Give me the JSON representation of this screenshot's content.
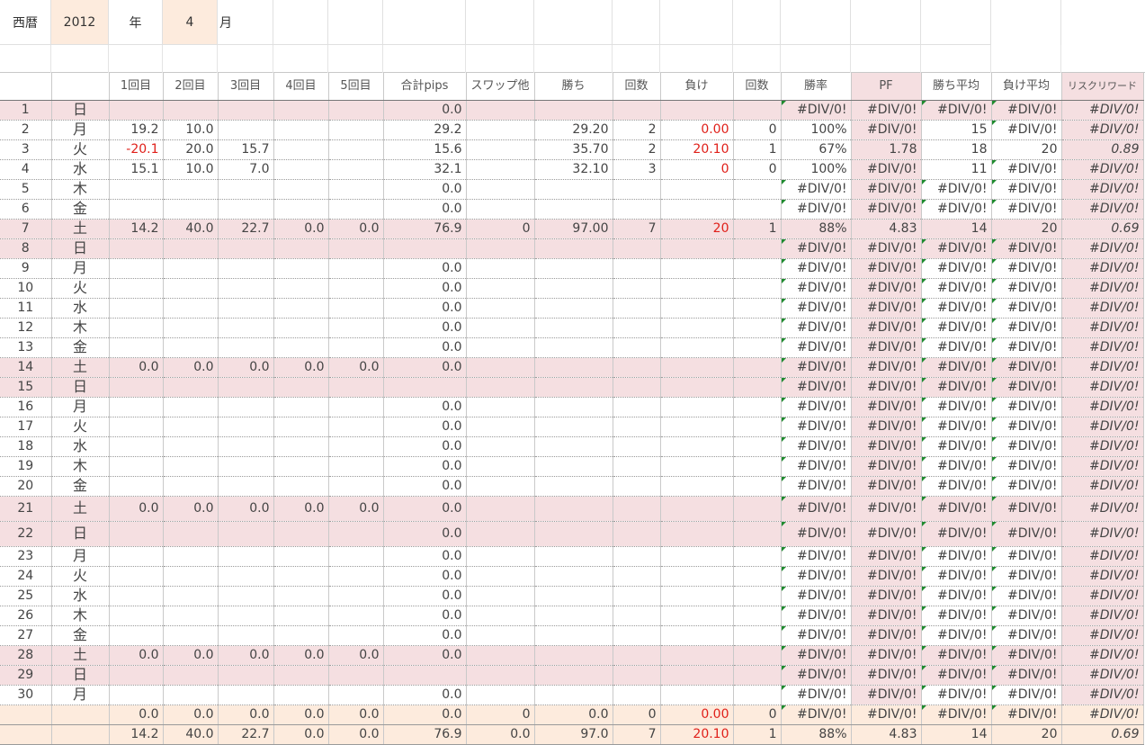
{
  "header": {
    "era_label": "西暦",
    "year": "2012",
    "year_unit": "年",
    "month": "4",
    "month_unit": "月"
  },
  "columns": [
    "",
    "",
    "1回目",
    "2回目",
    "3回目",
    "4回目",
    "5回目",
    "合計pips",
    "スワップ他",
    "勝ち",
    "回数",
    "負け",
    "回数",
    "勝率",
    "PF",
    "勝ち平均",
    "負け平均",
    "リスクリワード"
  ],
  "rows": [
    [
      "1",
      "日",
      "",
      "",
      "",
      "",
      "",
      "0.0",
      "",
      "",
      "",
      "",
      "",
      "#DIV/0!",
      "#DIV/0!",
      "#DIV/0!",
      "#DIV/0!",
      "#DIV/0!"
    ],
    [
      "2",
      "月",
      "19.2",
      "10.0",
      "",
      "",
      "",
      "29.2",
      "",
      "29.20",
      "2",
      "0.00",
      "0",
      "100%",
      "#DIV/0!",
      "15",
      "#DIV/0!",
      "#DIV/0!"
    ],
    [
      "3",
      "火",
      "-20.1",
      "20.0",
      "15.7",
      "",
      "",
      "15.6",
      "",
      "35.70",
      "2",
      "20.10",
      "1",
      "67%",
      "1.78",
      "18",
      "20",
      "0.89"
    ],
    [
      "4",
      "水",
      "15.1",
      "10.0",
      "7.0",
      "",
      "",
      "32.1",
      "",
      "32.10",
      "3",
      "0",
      "0",
      "100%",
      "#DIV/0!",
      "11",
      "#DIV/0!",
      "#DIV/0!"
    ],
    [
      "5",
      "木",
      "",
      "",
      "",
      "",
      "",
      "0.0",
      "",
      "",
      "",
      "",
      "",
      "#DIV/0!",
      "#DIV/0!",
      "#DIV/0!",
      "#DIV/0!",
      "#DIV/0!"
    ],
    [
      "6",
      "金",
      "",
      "",
      "",
      "",
      "",
      "0.0",
      "",
      "",
      "",
      "",
      "",
      "#DIV/0!",
      "#DIV/0!",
      "#DIV/0!",
      "#DIV/0!",
      "#DIV/0!"
    ],
    [
      "7",
      "土",
      "14.2",
      "40.0",
      "22.7",
      "0.0",
      "0.0",
      "76.9",
      "0",
      "97.00",
      "7",
      "20",
      "1",
      "88%",
      "4.83",
      "14",
      "20",
      "0.69"
    ],
    [
      "8",
      "日",
      "",
      "",
      "",
      "",
      "",
      "",
      "",
      "",
      "",
      "",
      "",
      "#DIV/0!",
      "#DIV/0!",
      "#DIV/0!",
      "#DIV/0!",
      "#DIV/0!"
    ],
    [
      "9",
      "月",
      "",
      "",
      "",
      "",
      "",
      "0.0",
      "",
      "",
      "",
      "",
      "",
      "#DIV/0!",
      "#DIV/0!",
      "#DIV/0!",
      "#DIV/0!",
      "#DIV/0!"
    ],
    [
      "10",
      "火",
      "",
      "",
      "",
      "",
      "",
      "0.0",
      "",
      "",
      "",
      "",
      "",
      "#DIV/0!",
      "#DIV/0!",
      "#DIV/0!",
      "#DIV/0!",
      "#DIV/0!"
    ],
    [
      "11",
      "水",
      "",
      "",
      "",
      "",
      "",
      "0.0",
      "",
      "",
      "",
      "",
      "",
      "#DIV/0!",
      "#DIV/0!",
      "#DIV/0!",
      "#DIV/0!",
      "#DIV/0!"
    ],
    [
      "12",
      "木",
      "",
      "",
      "",
      "",
      "",
      "0.0",
      "",
      "",
      "",
      "",
      "",
      "#DIV/0!",
      "#DIV/0!",
      "#DIV/0!",
      "#DIV/0!",
      "#DIV/0!"
    ],
    [
      "13",
      "金",
      "",
      "",
      "",
      "",
      "",
      "0.0",
      "",
      "",
      "",
      "",
      "",
      "#DIV/0!",
      "#DIV/0!",
      "#DIV/0!",
      "#DIV/0!",
      "#DIV/0!"
    ],
    [
      "14",
      "土",
      "0.0",
      "0.0",
      "0.0",
      "0.0",
      "0.0",
      "0.0",
      "",
      "",
      "",
      "",
      "",
      "#DIV/0!",
      "#DIV/0!",
      "#DIV/0!",
      "#DIV/0!",
      "#DIV/0!"
    ],
    [
      "15",
      "日",
      "",
      "",
      "",
      "",
      "",
      "",
      "",
      "",
      "",
      "",
      "",
      "#DIV/0!",
      "#DIV/0!",
      "#DIV/0!",
      "#DIV/0!",
      "#DIV/0!"
    ],
    [
      "16",
      "月",
      "",
      "",
      "",
      "",
      "",
      "0.0",
      "",
      "",
      "",
      "",
      "",
      "#DIV/0!",
      "#DIV/0!",
      "#DIV/0!",
      "#DIV/0!",
      "#DIV/0!"
    ],
    [
      "17",
      "火",
      "",
      "",
      "",
      "",
      "",
      "0.0",
      "",
      "",
      "",
      "",
      "",
      "#DIV/0!",
      "#DIV/0!",
      "#DIV/0!",
      "#DIV/0!",
      "#DIV/0!"
    ],
    [
      "18",
      "水",
      "",
      "",
      "",
      "",
      "",
      "0.0",
      "",
      "",
      "",
      "",
      "",
      "#DIV/0!",
      "#DIV/0!",
      "#DIV/0!",
      "#DIV/0!",
      "#DIV/0!"
    ],
    [
      "19",
      "木",
      "",
      "",
      "",
      "",
      "",
      "0.0",
      "",
      "",
      "",
      "",
      "",
      "#DIV/0!",
      "#DIV/0!",
      "#DIV/0!",
      "#DIV/0!",
      "#DIV/0!"
    ],
    [
      "20",
      "金",
      "",
      "",
      "",
      "",
      "",
      "0.0",
      "",
      "",
      "",
      "",
      "",
      "#DIV/0!",
      "#DIV/0!",
      "#DIV/0!",
      "#DIV/0!",
      "#DIV/0!"
    ],
    [
      "21",
      "土",
      "0.0",
      "0.0",
      "0.0",
      "0.0",
      "0.0",
      "0.0",
      "",
      "",
      "",
      "",
      "",
      "#DIV/0!",
      "#DIV/0!",
      "#DIV/0!",
      "#DIV/0!",
      "#DIV/0!"
    ],
    [
      "22",
      "日",
      "",
      "",
      "",
      "",
      "",
      "0.0",
      "",
      "",
      "",
      "",
      "",
      "#DIV/0!",
      "#DIV/0!",
      "#DIV/0!",
      "#DIV/0!",
      "#DIV/0!"
    ],
    [
      "23",
      "月",
      "",
      "",
      "",
      "",
      "",
      "0.0",
      "",
      "",
      "",
      "",
      "",
      "#DIV/0!",
      "#DIV/0!",
      "#DIV/0!",
      "#DIV/0!",
      "#DIV/0!"
    ],
    [
      "24",
      "火",
      "",
      "",
      "",
      "",
      "",
      "0.0",
      "",
      "",
      "",
      "",
      "",
      "#DIV/0!",
      "#DIV/0!",
      "#DIV/0!",
      "#DIV/0!",
      "#DIV/0!"
    ],
    [
      "25",
      "水",
      "",
      "",
      "",
      "",
      "",
      "0.0",
      "",
      "",
      "",
      "",
      "",
      "#DIV/0!",
      "#DIV/0!",
      "#DIV/0!",
      "#DIV/0!",
      "#DIV/0!"
    ],
    [
      "26",
      "木",
      "",
      "",
      "",
      "",
      "",
      "0.0",
      "",
      "",
      "",
      "",
      "",
      "#DIV/0!",
      "#DIV/0!",
      "#DIV/0!",
      "#DIV/0!",
      "#DIV/0!"
    ],
    [
      "27",
      "金",
      "",
      "",
      "",
      "",
      "",
      "0.0",
      "",
      "",
      "",
      "",
      "",
      "#DIV/0!",
      "#DIV/0!",
      "#DIV/0!",
      "#DIV/0!",
      "#DIV/0!"
    ],
    [
      "28",
      "土",
      "0.0",
      "0.0",
      "0.0",
      "0.0",
      "0.0",
      "0.0",
      "",
      "",
      "",
      "",
      "",
      "#DIV/0!",
      "#DIV/0!",
      "#DIV/0!",
      "#DIV/0!",
      "#DIV/0!"
    ],
    [
      "29",
      "日",
      "",
      "",
      "",
      "",
      "",
      "",
      "",
      "",
      "",
      "",
      "",
      "#DIV/0!",
      "#DIV/0!",
      "#DIV/0!",
      "#DIV/0!",
      "#DIV/0!"
    ],
    [
      "30",
      "月",
      "",
      "",
      "",
      "",
      "",
      "0.0",
      "",
      "",
      "",
      "",
      "",
      "#DIV/0!",
      "#DIV/0!",
      "#DIV/0!",
      "#DIV/0!",
      "#DIV/0!"
    ]
  ],
  "weekend_rows": [
    0,
    6,
    7,
    13,
    14,
    20,
    21,
    27,
    28
  ],
  "tall_rows": [
    20,
    21
  ],
  "red_cells": [
    [
      1,
      11
    ],
    [
      2,
      2
    ],
    [
      2,
      11
    ],
    [
      3,
      11
    ],
    [
      6,
      11
    ]
  ],
  "summary_rows": [
    [
      "",
      "",
      "0.0",
      "0.0",
      "0.0",
      "0.0",
      "0.0",
      "0.0",
      "0",
      "0.0",
      "0",
      "0.00",
      "0",
      "#DIV/0!",
      "#DIV/0!",
      "#DIV/0!",
      "#DIV/0!",
      "#DIV/0!"
    ],
    [
      "",
      "",
      "14.2",
      "40.0",
      "22.7",
      "0.0",
      "0.0",
      "76.9",
      "0.0",
      "97.0",
      "7",
      "20.10",
      "1",
      "88%",
      "4.83",
      "14",
      "20",
      "0.69"
    ]
  ],
  "summary_red_cells": [
    [
      0,
      11
    ],
    [
      1,
      11
    ]
  ],
  "colors": {
    "weekend": "#f5dfe1",
    "peach": "#fdebdd",
    "negative": "#e0201a",
    "error_marker": "#1e8a2e"
  }
}
